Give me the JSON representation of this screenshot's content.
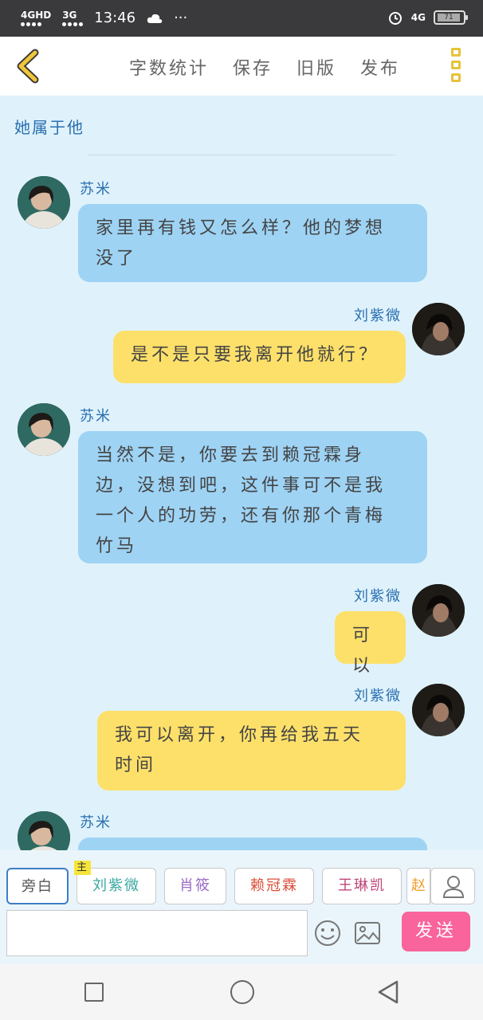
{
  "status": {
    "sim1": "4GHD",
    "sim2": "3G",
    "time": "13:46",
    "more": "···",
    "net_right": "4G",
    "battery": "71"
  },
  "toolbar": {
    "actions": [
      "字数统计",
      "保存",
      "旧版",
      "发布"
    ]
  },
  "story": {
    "title": "她属于他"
  },
  "messages": [
    {
      "sender": "苏米",
      "side": "left",
      "color": "blue",
      "text_lines": [
        "家里再有钱又怎么样？他的梦想",
        "没了"
      ]
    },
    {
      "sender": "刘紫微",
      "side": "right",
      "color": "yellow",
      "text_lines": [
        "是不是只要我离开他就行？"
      ]
    },
    {
      "sender": "苏米",
      "side": "left",
      "color": "blue",
      "text_lines": [
        "当然不是，你要去到赖冠霖身",
        "边，没想到吧，这件事可不是我",
        "一个人的功劳，还有你那个青梅",
        "竹马"
      ]
    },
    {
      "sender": "刘紫微",
      "side": "right",
      "color": "yellow",
      "text_lines": [
        "可以"
      ]
    },
    {
      "sender": "刘紫微",
      "side": "right",
      "color": "yellow",
      "text_lines": [
        "我可以离开，你再给我五天",
        "时间"
      ]
    },
    {
      "sender": "苏米",
      "side": "left",
      "color": "blue",
      "text_lines": [
        ""
      ]
    }
  ],
  "composer": {
    "roles": [
      {
        "label": "旁白",
        "color": "#555555"
      },
      {
        "label": "刘紫微",
        "color": "#3aa9a0",
        "tag": "主"
      },
      {
        "label": "肖筱",
        "color": "#9b6cc9"
      },
      {
        "label": "赖冠霖",
        "color": "#d9503a"
      },
      {
        "label": "王琳凯",
        "color": "#c0477a"
      }
    ],
    "more_role": "赵",
    "send_label": "发送"
  }
}
